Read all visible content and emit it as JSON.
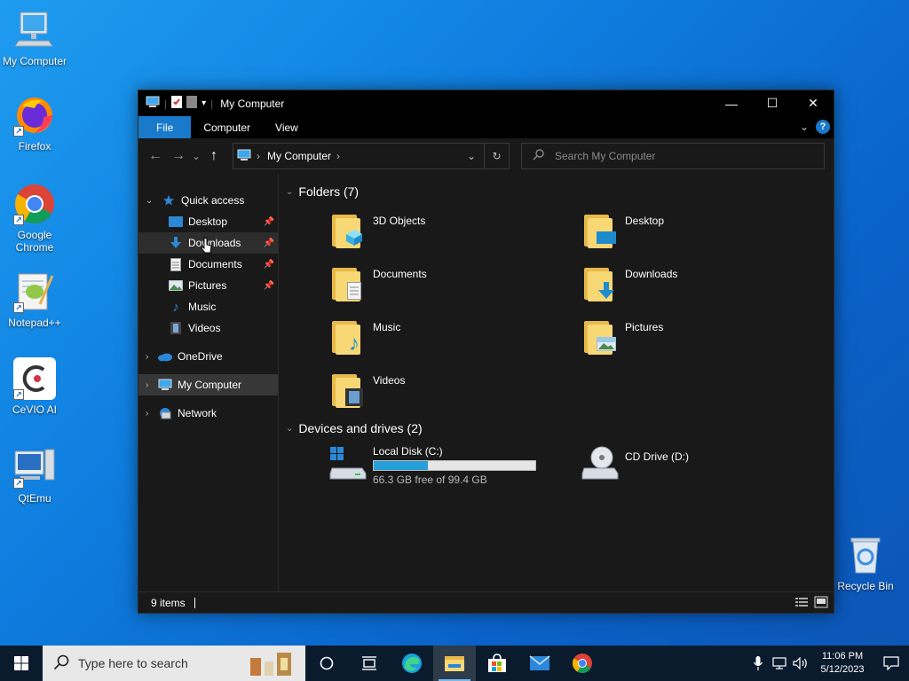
{
  "desktop": {
    "icons": [
      {
        "label": "My Computer",
        "icon": "computer-icon"
      },
      {
        "label": "Firefox",
        "icon": "firefox-icon"
      },
      {
        "label": "Google Chrome",
        "icon": "chrome-icon"
      },
      {
        "label": "Notepad++",
        "icon": "notepadpp-icon"
      },
      {
        "label": "CeVIO AI",
        "icon": "cevio-icon"
      },
      {
        "label": "QtEmu",
        "icon": "qtemu-icon"
      },
      {
        "label": "Recycle Bin",
        "icon": "recycle-bin-icon"
      }
    ]
  },
  "window": {
    "title": "My Computer",
    "controls": {
      "minimize": "—",
      "maximize": "☐",
      "close": "✕"
    },
    "ribbon_tabs": [
      "File",
      "Computer",
      "View"
    ],
    "help": "?",
    "nav": {
      "back": "←",
      "forward": "→",
      "recent": "⌄",
      "up": "↑"
    },
    "address": {
      "location": "My Computer",
      "sep": "›",
      "dropdown": "⌄",
      "refresh": "↻"
    },
    "search": {
      "placeholder": "Search My Computer"
    },
    "sidebar": {
      "quick_access": "Quick access",
      "items": [
        {
          "label": "Desktop",
          "pinned": true
        },
        {
          "label": "Downloads",
          "pinned": true
        },
        {
          "label": "Documents",
          "pinned": true
        },
        {
          "label": "Pictures",
          "pinned": true
        },
        {
          "label": "Music",
          "pinned": false
        },
        {
          "label": "Videos",
          "pinned": false
        }
      ],
      "onedrive": "OneDrive",
      "my_computer": "My Computer",
      "network": "Network"
    },
    "sections": {
      "folders_title": "Folders (7)",
      "drives_title": "Devices and drives (2)"
    },
    "folders": [
      "3D Objects",
      "Desktop",
      "Documents",
      "Downloads",
      "Music",
      "Pictures",
      "Videos"
    ],
    "drives": [
      {
        "name": "Local Disk (C:)",
        "free_text": "66.3 GB free of 99.4 GB",
        "used_fraction": 0.333
      },
      {
        "name": "CD Drive (D:)"
      }
    ],
    "status": {
      "items": "9 items"
    }
  },
  "taskbar": {
    "search_placeholder": "Type here to search",
    "clock_time": "11:06 PM",
    "clock_date": "5/12/2023"
  },
  "colors": {
    "accent": "#1979ca",
    "drive_bar": "#26a0da",
    "folder_yellow": "#f8d775"
  }
}
